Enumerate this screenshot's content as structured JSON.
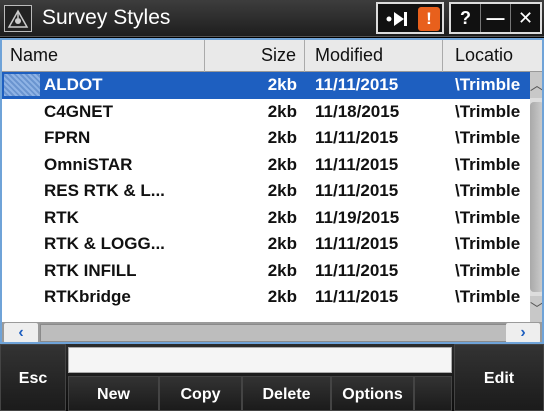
{
  "window": {
    "title": "Survey Styles"
  },
  "titlebar": {
    "help": "?",
    "minimize": "—",
    "close": "✕",
    "warning": "!"
  },
  "table": {
    "columns": [
      "Name",
      "Size",
      "Modified",
      "Locatio"
    ],
    "rows": [
      {
        "name": "ALDOT",
        "size": "2kb",
        "modified": "11/11/2015",
        "location": "\\Trimble"
      },
      {
        "name": "C4GNET",
        "size": "2kb",
        "modified": "11/18/2015",
        "location": "\\Trimble"
      },
      {
        "name": "FPRN",
        "size": "2kb",
        "modified": "11/11/2015",
        "location": "\\Trimble"
      },
      {
        "name": "OmniSTAR",
        "size": "2kb",
        "modified": "11/11/2015",
        "location": "\\Trimble"
      },
      {
        "name": "RES RTK & L...",
        "size": "2kb",
        "modified": "11/11/2015",
        "location": "\\Trimble"
      },
      {
        "name": "RTK",
        "size": "2kb",
        "modified": "11/19/2015",
        "location": "\\Trimble"
      },
      {
        "name": "RTK & LOGG...",
        "size": "2kb",
        "modified": "11/11/2015",
        "location": "\\Trimble"
      },
      {
        "name": "RTK INFILL",
        "size": "2kb",
        "modified": "11/11/2015",
        "location": "\\Trimble"
      },
      {
        "name": "RTKbridge",
        "size": "2kb",
        "modified": "11/11/2015",
        "location": "\\Trimble"
      }
    ],
    "selected_index": 0
  },
  "softkeys": {
    "esc": "Esc",
    "new": "New",
    "copy": "Copy",
    "delete": "Delete",
    "options": "Options",
    "edit": "Edit"
  },
  "colors": {
    "selection": "#1e5fc0",
    "warning": "#e8601c"
  }
}
